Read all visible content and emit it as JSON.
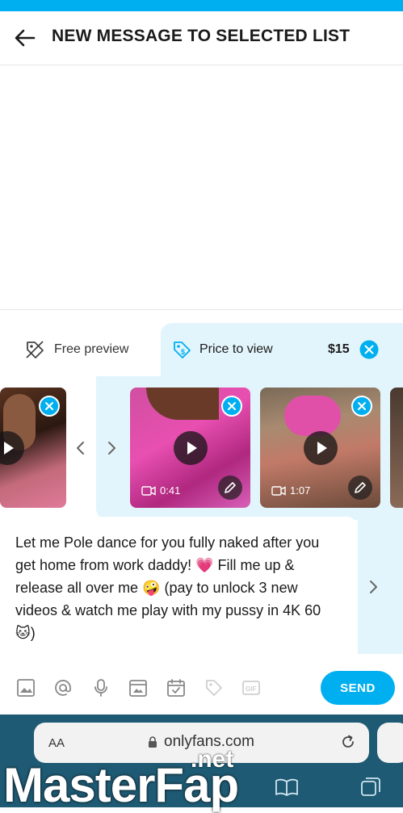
{
  "header": {
    "title": "NEW MESSAGE TO SELECTED LIST"
  },
  "tabs": {
    "free_preview": "Free preview",
    "price_to_view": "Price to view",
    "price": "$15"
  },
  "media": [
    {
      "duration": ""
    },
    {
      "duration": "0:41"
    },
    {
      "duration": "1:07"
    }
  ],
  "message": {
    "text": "Let me Pole dance for you fully naked after you get home from work daddy! 💗 Fill me up & release all over me 🤪 (pay to unlock 3 new videos & watch me play with my pussy in 4K 60 🐱)"
  },
  "toolbar": {
    "send_label": "SEND"
  },
  "browser": {
    "aa": "AA",
    "url": "onlyfans.com"
  },
  "watermark": {
    "main": "MasterFap",
    "net": ".net"
  },
  "colors": {
    "accent": "#00aff0",
    "panel": "#e3f5fc"
  }
}
